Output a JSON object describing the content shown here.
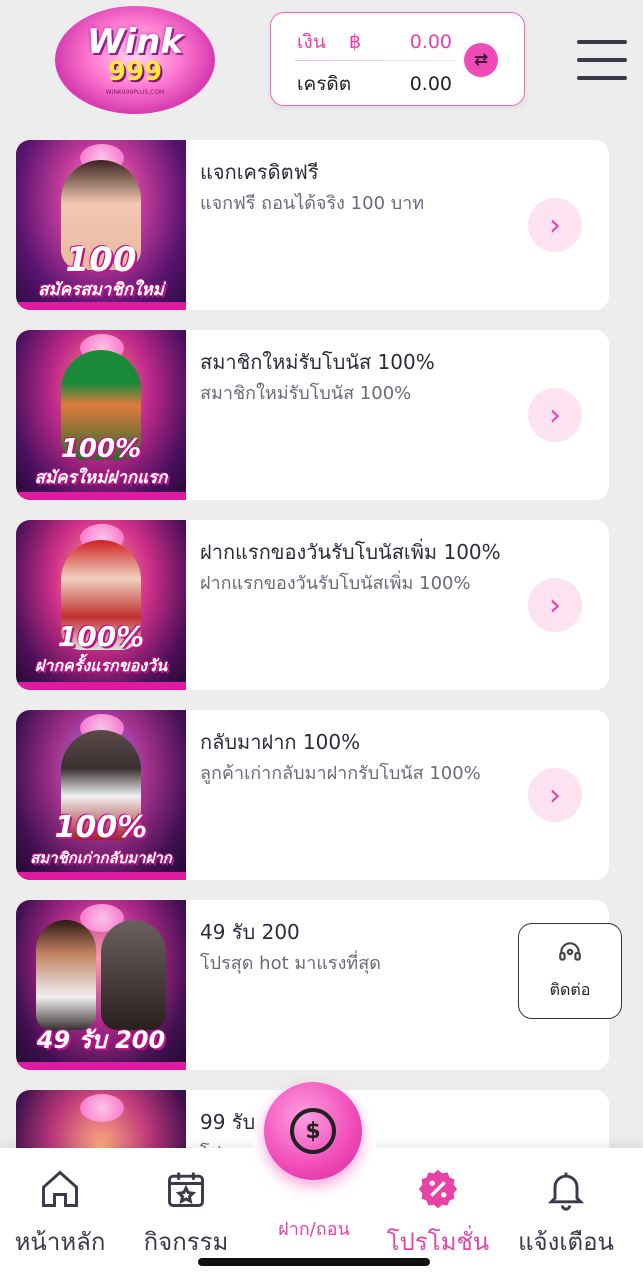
{
  "header": {
    "logo_text": "Wink",
    "logo_number": "999",
    "logo_url": "WINK999PLUS.COM",
    "wallet": {
      "money_label": "เงิน",
      "currency_symbol": "฿",
      "money_value": "0.00",
      "credit_label": "เครดิต",
      "credit_value": "0.00"
    },
    "icons": {
      "swap": "swap-arrows-icon",
      "menu": "hamburger-menu-icon"
    }
  },
  "promotions": [
    {
      "title": "แจกเครดิตฟรี",
      "desc": "แจกฟรี ถอนได้จริง 100 บาท",
      "banner_text": "100",
      "banner_sub": "สมัครสมาชิกใหม่"
    },
    {
      "title": "สมาชิกใหม่รับโบนัส 100%",
      "desc": "สมาชิกใหม่รับโบนัส 100%",
      "banner_text": "100%",
      "banner_sub": "สมัครใหม่ฝากแรก"
    },
    {
      "title": "ฝากแรกของวันรับโบนัสเพิ่ม 100%",
      "desc": "ฝากแรกของวันรับโบนัสเพิ่ม 100%",
      "banner_text": "100%",
      "banner_sub": "ฝากครั้งแรกของวัน"
    },
    {
      "title": "กลับมาฝาก 100%",
      "desc": "ลูกค้าเก่ากลับมาฝากรับโบนัส 100%",
      "banner_text": "100%",
      "banner_sub": "สมาชิกเก่ากลับมาฝาก"
    },
    {
      "title": "49 รับ 200",
      "desc": "โปรสุด hot มาแรงที่สุด",
      "banner_text": "49 รับ 200",
      "banner_sub": ""
    },
    {
      "title": "99 รับ",
      "desc": "โปรสุด hot มาแรงที่สุด",
      "banner_text": "",
      "banner_sub": ""
    }
  ],
  "contact": {
    "label": "ติดต่อ",
    "icon": "headset-icon"
  },
  "bottom_nav": {
    "home": "หน้าหลัก",
    "activities": "กิจกรรม",
    "deposit": "ฝาก/ถอน",
    "promotions": "โปรโมชั่น",
    "notifications": "แจ้งเตือน",
    "active": "promotions"
  },
  "colors": {
    "accent": "#e642a8",
    "background": "#ededed",
    "card": "#ffffff"
  }
}
